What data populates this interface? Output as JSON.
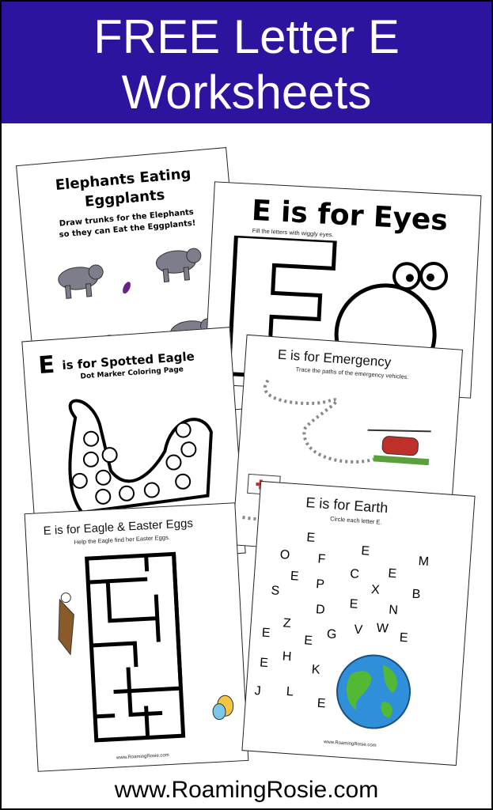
{
  "banner": {
    "line1": "FREE Letter E",
    "line2": "Worksheets",
    "color": "#2e139e"
  },
  "sheets": {
    "elephants": {
      "title1": "Elephants Eating",
      "title2": "Eggplants",
      "subtitle1": "Draw trunks for the Elephants",
      "subtitle2": "so they can Eat the Eggplants!"
    },
    "eyes": {
      "title": "E is for Eyes",
      "instruction": "Fill the letters with wiggly eyes."
    },
    "spotted_eagle": {
      "big_letter": "E",
      "title": "is for Spotted Eagle",
      "subtitle": "Dot Marker Coloring Page"
    },
    "emergency": {
      "title": "E is for Emergency",
      "instruction": "Trace the paths of the emergency vehicles."
    },
    "eagle_eggs": {
      "title": "E is for Eagle & Easter Eggs",
      "instruction": "Help the Eagle find her Easter Eggs.",
      "credit": "www.RoamingRosie.com"
    },
    "earth": {
      "title": "E is for Earth",
      "instruction": "Circle each letter E.",
      "credit": "www.RoamingRosie.com",
      "letters": [
        "E",
        "O",
        "F",
        "E",
        "M",
        "C",
        "E",
        "E",
        "P",
        "X",
        "B",
        "S",
        "E",
        "N",
        "D",
        "Z",
        "W",
        "V",
        "E",
        "G",
        "E",
        "E",
        "E",
        "H",
        "K",
        "E",
        "L",
        "J",
        "E"
      ]
    }
  },
  "footer": {
    "url": "www.RoamingRosie.com"
  }
}
